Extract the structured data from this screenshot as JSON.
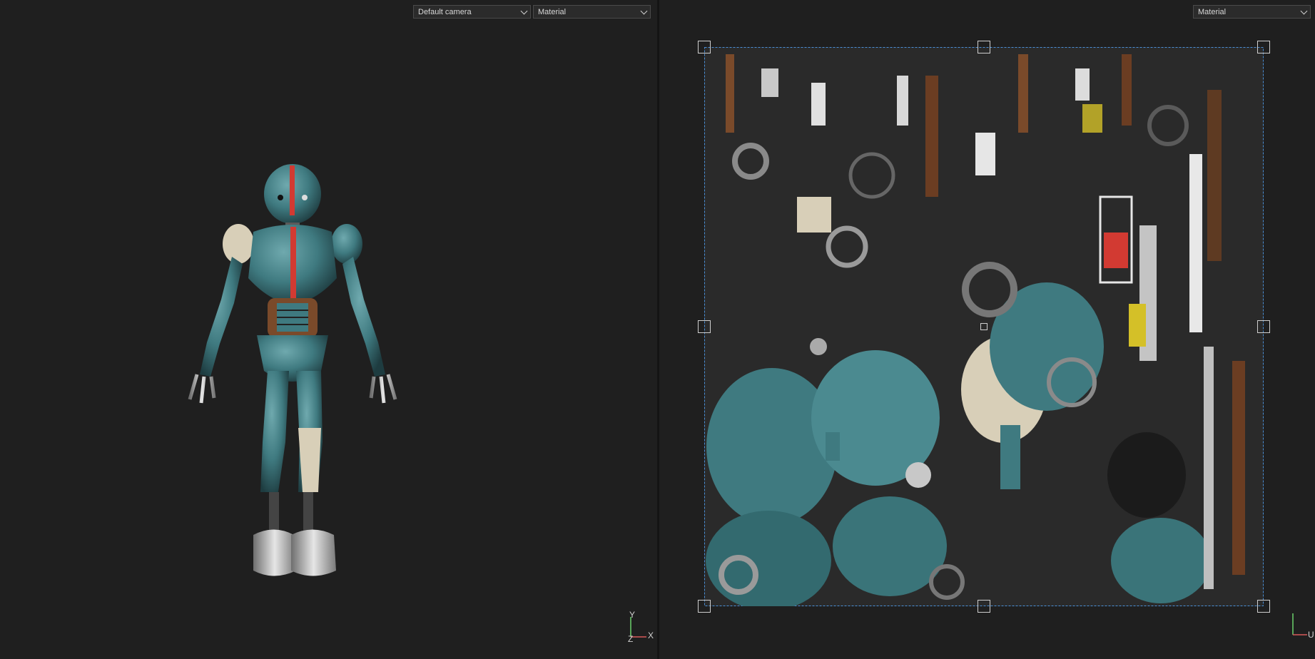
{
  "viewport_3d": {
    "camera_select": {
      "value": "Default camera"
    },
    "shading_select": {
      "value": "Material"
    },
    "axis_gizmo": {
      "x_label": "X",
      "y_label": "Y",
      "z_label": "Z"
    }
  },
  "uv_viewport": {
    "shading_select": {
      "value": "Material"
    },
    "axis_gizmo": {
      "u_label": "U"
    }
  },
  "colors": {
    "background": "#1f1f1f",
    "robot_teal": "#3f7a80",
    "accent_red": "#d23a32",
    "uv_bound": "#4a8fd6"
  }
}
